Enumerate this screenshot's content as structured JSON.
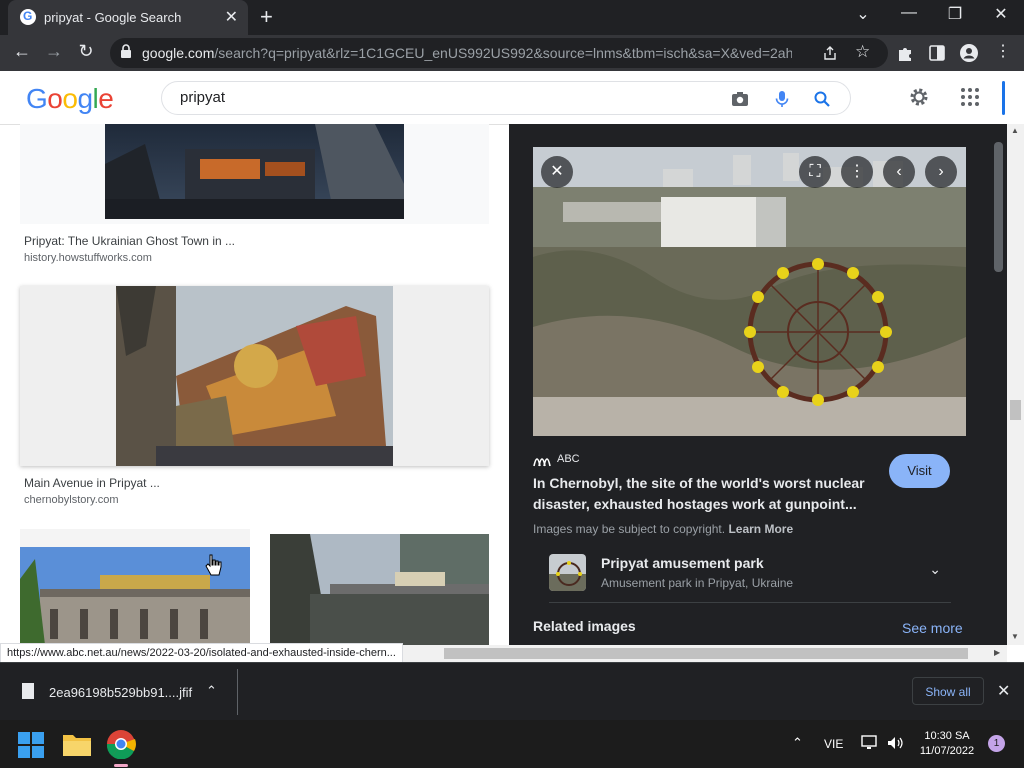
{
  "browser": {
    "tab_title": "pripyat - Google Search",
    "tab_close": "✕",
    "new_tab": "+",
    "url_host": "google.com",
    "url_path": "/search?q=pripyat&rlz=1C1GCEU_enUS992US992&source=lnms&tbm=isch&sa=X&ved=2ahU...",
    "window_controls": [
      "⌄",
      "—",
      "❐",
      "✕"
    ]
  },
  "google": {
    "logo_letters": [
      "G",
      "o",
      "o",
      "g",
      "l",
      "e"
    ],
    "logo_colors": [
      "#4285f4",
      "#ea4335",
      "#fbbc05",
      "#4285f4",
      "#34a853",
      "#ea4335"
    ],
    "search_query": "pripyat"
  },
  "results": [
    {
      "title": "Pripyat: The Ukrainian Ghost Town in ...",
      "site": "history.howstuffworks.com"
    },
    {
      "title": "Main Avenue in Pripyat ...",
      "site": "chernobylstory.com"
    }
  ],
  "preview": {
    "source": "ABC",
    "title": "In Chernobyl, the site of the world's worst nuclear disaster, exhausted hostages work at gunpoint...",
    "visit_label": "Visit",
    "copyright_text": "Images may be subject to copyright. ",
    "learn_more": "Learn More",
    "entity_name": "Pripyat amusement park",
    "entity_desc": "Amusement park in Pripyat, Ukraine",
    "related_label": "Related images",
    "see_more_label": "See more"
  },
  "status_url": "https://www.abc.net.au/news/2022-03-20/isolated-and-exhausted-inside-chern...",
  "download": {
    "filename": "2ea96198b529bb91....jfif",
    "show_all": "Show all"
  },
  "taskbar": {
    "language": "VIE",
    "time": "10:30 SA",
    "date": "11/07/2022",
    "notification_count": "1"
  }
}
